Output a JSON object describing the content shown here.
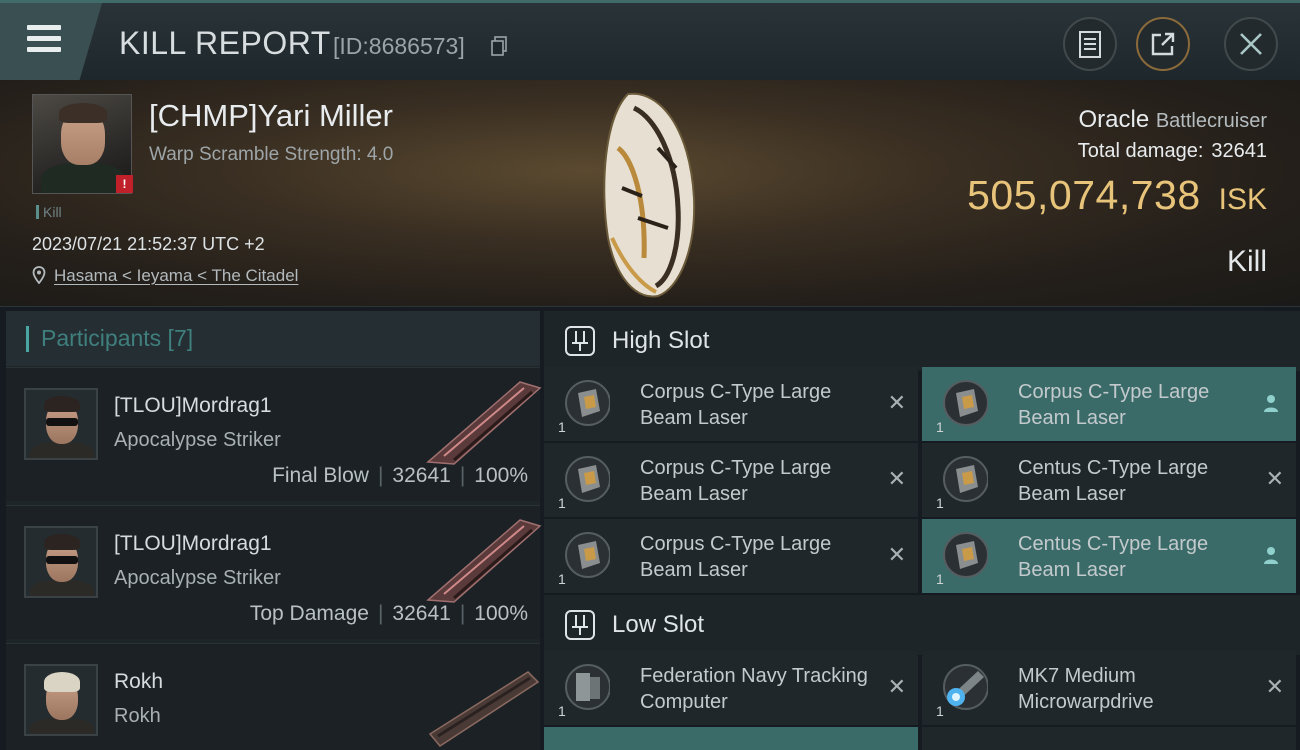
{
  "header": {
    "title": "KILL REPORT",
    "report_id": "[ID:8686573]"
  },
  "victim": {
    "name": "[CHMP]Yari Miller",
    "warp_scramble": "Warp Scramble Strength: 4.0",
    "kill_tag": "Kill",
    "datetime": "2023/07/21 21:52:37 UTC +2",
    "location": "Hasama < Ieyama < The Citadel",
    "ship": "Oracle",
    "ship_class": "Battlecruiser",
    "damage_label": "Total damage:",
    "damage_value": "32641",
    "isk_value": "505,074,738",
    "isk_unit": "ISK",
    "result": "Kill"
  },
  "participants": {
    "header": "Participants [7]",
    "rows": [
      {
        "name": "[TLOU]Mordrag1",
        "ship": "Apocalypse Striker",
        "role": "Final Blow",
        "damage": "32641",
        "percent": "100%"
      },
      {
        "name": "[TLOU]Mordrag1",
        "ship": "Apocalypse Striker",
        "role": "Top Damage",
        "damage": "32641",
        "percent": "100%"
      },
      {
        "name": "Rokh",
        "ship": "Rokh",
        "role": "",
        "damage": "",
        "percent": ""
      }
    ]
  },
  "slots": {
    "high": {
      "title": "High Slot",
      "modules": [
        {
          "name": "Corpus C-Type Large Beam Laser",
          "qty": "1",
          "dropped": false
        },
        {
          "name": "Corpus C-Type Large Beam Laser",
          "qty": "1",
          "dropped": true
        },
        {
          "name": "Corpus C-Type Large Beam Laser",
          "qty": "1",
          "dropped": false
        },
        {
          "name": "Centus C-Type Large Beam Laser",
          "qty": "1",
          "dropped": false
        },
        {
          "name": "Corpus C-Type Large Beam Laser",
          "qty": "1",
          "dropped": false
        },
        {
          "name": "Centus C-Type Large Beam Laser",
          "qty": "1",
          "dropped": true
        }
      ]
    },
    "low": {
      "title": "Low Slot",
      "modules": [
        {
          "name": "Federation Navy Tracking Computer",
          "qty": "1",
          "dropped": false
        },
        {
          "name": "MK7 Medium Microwarpdrive",
          "qty": "1",
          "dropped": false
        }
      ]
    }
  },
  "icons": {
    "menu": "hamburger-icon",
    "copy": "copy-icon",
    "report": "clipboard-icon",
    "share": "share-icon",
    "close": "close-icon"
  },
  "colors": {
    "accent": "#4aa6a3",
    "isk": "#e8c47a",
    "highlight": "#3b6b68",
    "alert": "#c0202a"
  }
}
